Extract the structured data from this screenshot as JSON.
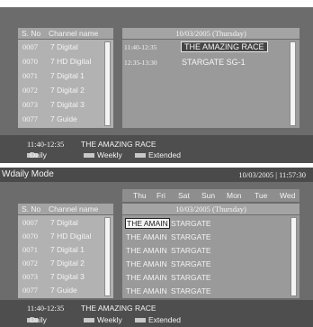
{
  "screen1": {
    "header": {
      "col_no": "S. No",
      "col_name": "Channel name",
      "date": "10/03/2005 (Thursday)"
    },
    "channels": [
      {
        "no": "0007",
        "name": "7 Digital"
      },
      {
        "no": "0070",
        "name": "7 HD Digital"
      },
      {
        "no": "0071",
        "name": "7 Digital 1"
      },
      {
        "no": "0072",
        "name": "7 Digital 2"
      },
      {
        "no": "0073",
        "name": "7 Digital 3"
      },
      {
        "no": "0077",
        "name": "7 Guide"
      }
    ],
    "events": [
      {
        "time": "11:40-12:35",
        "title": "THE AMAZING RACE"
      },
      {
        "time": "12:35-13:30",
        "title": "STARGATE SG-1"
      }
    ],
    "status": {
      "time": "11:40-12:35",
      "title": "THE AMAZING RACE"
    },
    "legend": {
      "daily": "Daily",
      "weekly": "Weekly",
      "extended": "Extended"
    }
  },
  "screen2": {
    "mode_title": "Wdaily Mode",
    "clock": "10/03/2005 | 11:57:30",
    "days": [
      "Thu",
      "Fri",
      "Sat",
      "Sun",
      "Mon",
      "Tue",
      "Wed"
    ],
    "header": {
      "col_no": "S. No",
      "col_name": "Channel name",
      "date": "10/03/2005 (Thursday)"
    },
    "channels": [
      {
        "no": "0007",
        "name": "7 Digital"
      },
      {
        "no": "0070",
        "name": "7 HD Digital"
      },
      {
        "no": "0071",
        "name": "7 Digital 1"
      },
      {
        "no": "0072",
        "name": "7 Digital 2"
      },
      {
        "no": "0073",
        "name": "7 Digital 3"
      },
      {
        "no": "0077",
        "name": "7 Guide"
      }
    ],
    "grid": [
      {
        "a": "THE AMAIN",
        "b": "STARGATE"
      },
      {
        "a": "THE AMAIN",
        "b": "STARGATE"
      },
      {
        "a": "THE AMAIN",
        "b": "STARGATE"
      },
      {
        "a": "THE AMAIN",
        "b": "STARGATE"
      },
      {
        "a": "THE AMAIN",
        "b": "STARGATE"
      },
      {
        "a": "THE AMAIN",
        "b": "STARGATE"
      }
    ],
    "status": {
      "time": "11:40-12:35",
      "title": "THE AMAZING RACE"
    },
    "legend": {
      "daily": "Daily",
      "weekly": "Weekly",
      "extended": "Extended"
    }
  },
  "colors": {
    "panel": "#6c6c6c",
    "bar": "#4e4e4e",
    "list": "#b2b2b2",
    "header": "#a4a4a4"
  }
}
